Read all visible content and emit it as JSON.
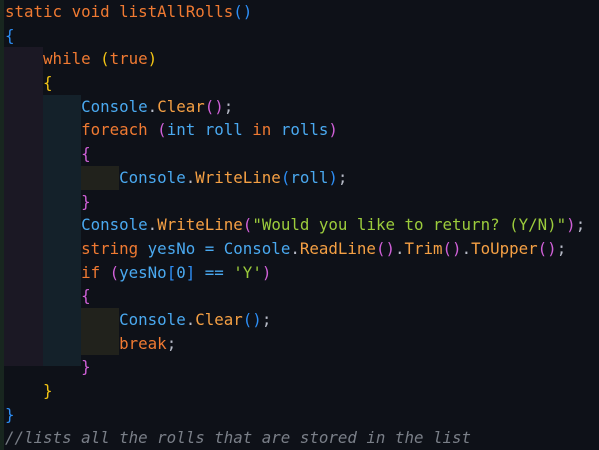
{
  "editor": {
    "lines": [
      [
        [
          "static void listAllRolls",
          "kw"
        ],
        [
          "()",
          "p1"
        ]
      ],
      [
        [
          "{",
          "p1"
        ]
      ],
      [
        [
          "    while ",
          "kw"
        ],
        [
          "(",
          "p2"
        ],
        [
          "true",
          "kw"
        ],
        [
          ")",
          "p2"
        ]
      ],
      [
        [
          "    ",
          " "
        ],
        [
          "{",
          "p2"
        ]
      ],
      [
        [
          "        Console",
          "id"
        ],
        [
          ".",
          "pu"
        ],
        [
          "Clear",
          "fn"
        ],
        [
          "()",
          "p3"
        ],
        [
          ";",
          "pu"
        ]
      ],
      [
        [
          "        foreach ",
          "kw"
        ],
        [
          "(",
          "p3"
        ],
        [
          "int roll ",
          "id"
        ],
        [
          "in ",
          "kw"
        ],
        [
          "rolls",
          "id"
        ],
        [
          ")",
          "p3"
        ]
      ],
      [
        [
          "        ",
          " "
        ],
        [
          "{",
          "p3"
        ]
      ],
      [
        [
          "            Console",
          "id"
        ],
        [
          ".",
          "pu"
        ],
        [
          "WriteLine",
          "fn"
        ],
        [
          "(",
          "p1"
        ],
        [
          "roll",
          "id"
        ],
        [
          ")",
          "p1"
        ],
        [
          ";",
          "pu"
        ]
      ],
      [
        [
          "        ",
          " "
        ],
        [
          "}",
          "p3"
        ]
      ],
      [
        [
          "        Console",
          "id"
        ],
        [
          ".",
          "pu"
        ],
        [
          "WriteLine",
          "fn"
        ],
        [
          "(",
          "p3"
        ],
        [
          "\"Would you like to return? (Y/N)\"",
          "str"
        ],
        [
          ")",
          "p3"
        ],
        [
          ";",
          "pu"
        ]
      ],
      [
        [
          "        string ",
          "kw"
        ],
        [
          "yesNo = Console",
          "id"
        ],
        [
          ".",
          "pu"
        ],
        [
          "ReadLine",
          "fn"
        ],
        [
          "()",
          "p3"
        ],
        [
          ".",
          "pu"
        ],
        [
          "Trim",
          "fn"
        ],
        [
          "()",
          "p3"
        ],
        [
          ".",
          "pu"
        ],
        [
          "ToUpper",
          "fn"
        ],
        [
          "()",
          "p3"
        ],
        [
          ";",
          "pu"
        ]
      ],
      [
        [
          "        if ",
          "kw"
        ],
        [
          "(",
          "p3"
        ],
        [
          "yesNo",
          "id"
        ],
        [
          "[",
          "p1"
        ],
        [
          "0",
          "op"
        ],
        [
          "]",
          "p1"
        ],
        [
          " == ",
          "op"
        ],
        [
          "'Y'",
          "str"
        ],
        [
          ")",
          "p3"
        ]
      ],
      [
        [
          "        ",
          " "
        ],
        [
          "{",
          "p3"
        ]
      ],
      [
        [
          "            Console",
          "id"
        ],
        [
          ".",
          "pu"
        ],
        [
          "Clear",
          "fn"
        ],
        [
          "()",
          "p1"
        ],
        [
          ";",
          "pu"
        ]
      ],
      [
        [
          "            break",
          "kw"
        ],
        [
          ";",
          "pu"
        ]
      ],
      [
        [
          "        ",
          " "
        ],
        [
          "}",
          "p3"
        ]
      ],
      [
        [
          "    ",
          " "
        ],
        [
          "}",
          "p2"
        ]
      ],
      [
        [
          "}",
          "p1"
        ]
      ],
      [
        [
          "//lists all the rolls that are stored in the list",
          "cm"
        ]
      ]
    ]
  }
}
